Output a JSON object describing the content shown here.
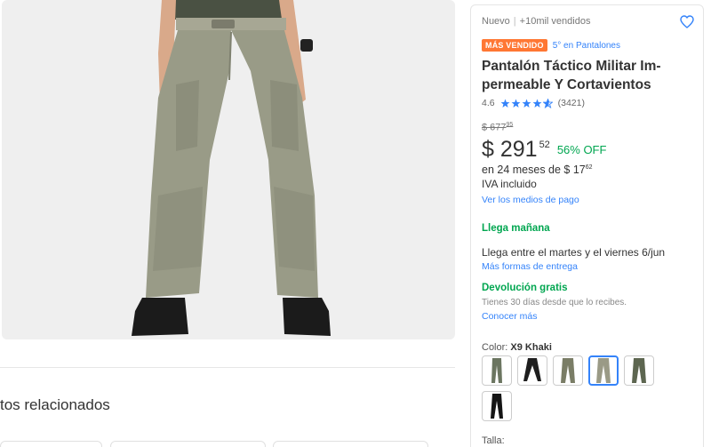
{
  "product": {
    "condition": "Nuevo",
    "sold": "+10mil vendidos",
    "badge": "MÁS VENDIDO",
    "rank": "5° en Pantalones",
    "title_line1": "Pantalón Táctico Militar Im-",
    "title_line2": "permeable Y Cortavientos",
    "rating": "4.6",
    "rating_value": 4.6,
    "reviews": "(3421)",
    "old_price_int": "$ 677",
    "old_price_cents": "95",
    "price_int": "$ 291",
    "price_cents": "52",
    "discount": "56% OFF",
    "installments_text": "en 24 meses de $ 17",
    "installments_cents": "62",
    "iva": "IVA incluido",
    "payment_link": "Ver los medios de pago"
  },
  "shipping": {
    "arrives": "Llega mañana",
    "detail": "Llega entre el martes y el viernes 6/jun",
    "more_link": "Más formas de entrega"
  },
  "returns": {
    "title": "Devolución gratis",
    "detail": "Tienes 30 días desde que lo recibes.",
    "link": "Conocer más"
  },
  "variants": {
    "color_label": "Color:",
    "color_selected": "X9 Khaki",
    "swatches": [
      {
        "name": "green-pants-swatch",
        "color": "#6b7560",
        "selected": false
      },
      {
        "name": "black-pants-swatch",
        "color": "#1e1e1e",
        "selected": false
      },
      {
        "name": "olive-pants-swatch",
        "color": "#7a7d66",
        "selected": false
      },
      {
        "name": "khaki-pants-swatch",
        "color": "#9a9a86",
        "selected": true
      },
      {
        "name": "army-green-pants-swatch",
        "color": "#5d6650",
        "selected": false
      },
      {
        "name": "dark-black-pants-swatch",
        "color": "#151515",
        "selected": false
      }
    ],
    "size_label": "Talla:"
  },
  "related": {
    "title": "tos relacionados"
  },
  "colors": {
    "accent": "#3483fa",
    "green": "#00a650",
    "badge": "#ff7733",
    "pants": "#999b87"
  }
}
